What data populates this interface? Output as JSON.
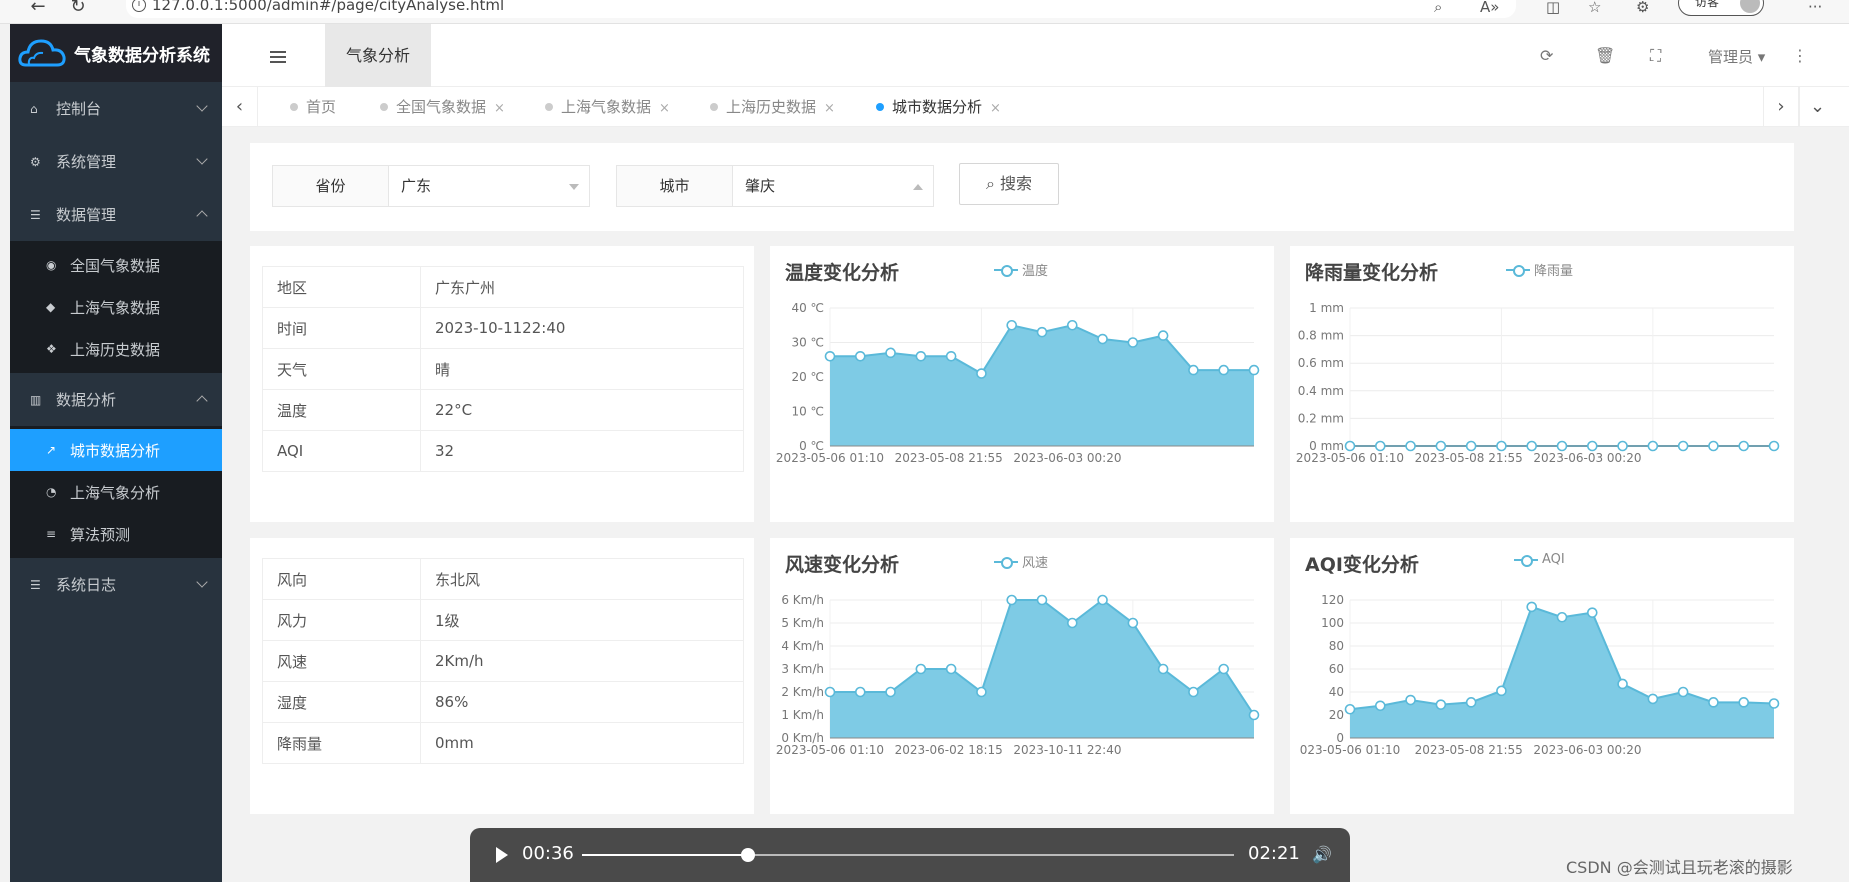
{
  "browser": {
    "url": "127.0.0.1:5000/admin#/page/cityAnalyse.html",
    "profile_label": "访客"
  },
  "sidebar": {
    "logo_text": "气象数据分析系统",
    "menu": [
      {
        "label": "控制台",
        "icon": "home-icon"
      },
      {
        "label": "系统管理",
        "icon": "gears-icon"
      },
      {
        "label": "数据管理",
        "icon": "server-icon"
      },
      {
        "label": "数据分析",
        "icon": "bar-chart-icon"
      },
      {
        "label": "系统日志",
        "icon": "server-icon"
      }
    ],
    "data_mgmt_sub": [
      {
        "label": "全国气象数据",
        "icon": "globe-icon"
      },
      {
        "label": "上海气象数据",
        "icon": "cube-icon"
      },
      {
        "label": "上海历史数据",
        "icon": "cubes-icon"
      }
    ],
    "analysis_sub": [
      {
        "label": "城市数据分析",
        "icon": "line-chart-icon"
      },
      {
        "label": "上海气象分析",
        "icon": "pie-chart-icon"
      },
      {
        "label": "算法预测",
        "icon": "database-icon"
      }
    ]
  },
  "header": {
    "active_tab": "气象分析",
    "admin_label": "管理员"
  },
  "tabs": [
    {
      "label": "首页"
    },
    {
      "label": "全国气象数据",
      "close": "×"
    },
    {
      "label": "上海气象数据",
      "close": "×"
    },
    {
      "label": "上海历史数据",
      "close": "×"
    },
    {
      "label": "城市数据分析",
      "close": "×"
    }
  ],
  "search": {
    "province_label": "省份",
    "province_value": "广东",
    "city_label": "城市",
    "city_value": "肇庆",
    "button_label": "搜索"
  },
  "info_top": [
    {
      "k": "地区",
      "v": "广东广州"
    },
    {
      "k": "时间",
      "v": "2023-10-1122:40"
    },
    {
      "k": "天气",
      "v": "晴"
    },
    {
      "k": "温度",
      "v": "22°C"
    },
    {
      "k": "AQI",
      "v": "32"
    }
  ],
  "info_bottom": [
    {
      "k": "风向",
      "v": "东北风"
    },
    {
      "k": "风力",
      "v": "1级"
    },
    {
      "k": "风速",
      "v": "2Km/h"
    },
    {
      "k": "湿度",
      "v": "86%"
    },
    {
      "k": "降雨量",
      "v": "0mm"
    }
  ],
  "chart_data": [
    {
      "type": "area",
      "title": "温度变化分析",
      "legend": "温度",
      "x_ticks": [
        "2023-05-06 01:10",
        "2023-05-08 21:55",
        "2023-06-03 00:20"
      ],
      "y_ticks": [
        "0 ℃",
        "10 ℃",
        "20 ℃",
        "30 ℃",
        "40 ℃"
      ],
      "ylim": [
        0,
        40
      ],
      "values": [
        26,
        26,
        27,
        26,
        26,
        21,
        35,
        33,
        35,
        31,
        30,
        32,
        22,
        22,
        22
      ],
      "color": "#7ecbe5"
    },
    {
      "type": "area",
      "title": "降雨量变化分析",
      "legend": "降雨量",
      "x_ticks": [
        "2023-05-06 01:10",
        "2023-05-08 21:55",
        "2023-06-03 00:20"
      ],
      "y_ticks": [
        "0 mm",
        "0.2 mm",
        "0.4 mm",
        "0.6 mm",
        "0.8 mm",
        "1 mm"
      ],
      "ylim": [
        0,
        1
      ],
      "values": [
        0,
        0,
        0,
        0,
        0,
        0,
        0,
        0,
        0,
        0,
        0,
        0,
        0,
        0,
        0
      ],
      "color": "#7ecbe5"
    },
    {
      "type": "area",
      "title": "风速变化分析",
      "legend": "风速",
      "x_ticks": [
        "2023-05-06 01:10",
        "2023-06-02 18:15",
        "2023-10-11 22:40"
      ],
      "y_ticks": [
        "0 Km/h",
        "1 Km/h",
        "2 Km/h",
        "3 Km/h",
        "4 Km/h",
        "5 Km/h",
        "6 Km/h"
      ],
      "ylim": [
        0,
        6
      ],
      "values": [
        2,
        2,
        2,
        3,
        3,
        2,
        6,
        6,
        5,
        6,
        5,
        3,
        2,
        3,
        1
      ],
      "color": "#7ecbe5"
    },
    {
      "type": "area",
      "title": "AQI变化分析",
      "legend": "AQI",
      "x_ticks": [
        "023-05-06 01:10",
        "2023-05-08 21:55",
        "2023-06-03 00:20"
      ],
      "y_ticks": [
        "0",
        "20",
        "40",
        "60",
        "80",
        "100",
        "120"
      ],
      "ylim": [
        0,
        120
      ],
      "values": [
        25,
        28,
        33,
        29,
        31,
        41,
        114,
        105,
        109,
        47,
        34,
        40,
        31,
        31,
        30
      ],
      "color": "#7ecbe5"
    }
  ],
  "video": {
    "current_time": "00:36",
    "total_time": "02:21",
    "progress": 0.255
  },
  "watermark": "CSDN @会测试且玩老滚的摄影"
}
